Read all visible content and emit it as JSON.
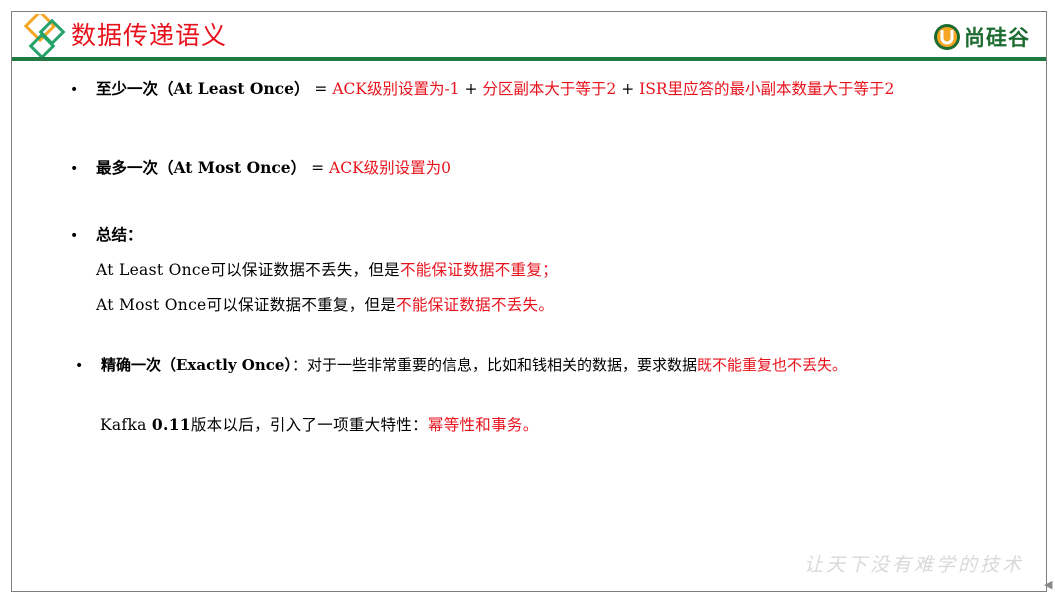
{
  "header": {
    "title": "数据传递语义",
    "brand_name": "尚硅谷",
    "colors": {
      "title": "#e8121c",
      "rule": "#1f7a44",
      "brand": "#1c6b2f",
      "diamond_orange": "#f5a623",
      "diamond_green": "#23a36a"
    }
  },
  "bullet_glyph": "•",
  "items": {
    "at_least_once": {
      "label": "至少一次（At Least Once）",
      "eq": " = ",
      "part1": "ACK级别设置为-1",
      "plus1": " + ",
      "part2": "分区副本大于等于2",
      "plus2": " + ",
      "part3": "ISR里应答的最小副本数量大于等于2"
    },
    "at_most_once": {
      "label": "最多一次（At Most Once）",
      "eq": " = ",
      "part1": "ACK级别设置为0"
    },
    "summary": {
      "label": "总结：",
      "line1_black": "At  Least  Once可以保证数据不丢失，但是",
      "line1_red": "不能保证数据不重复；",
      "line2_black": "At  Most  Once可以保证数据不重复，但是",
      "line2_red": "不能保证数据不丢失。"
    },
    "exactly_once": {
      "label": "精确一次（Exactly  Once）",
      "text_black": "：对于一些非常重要的信息，比如和钱相关的数据，要求数据",
      "text_red": "既不能重复也不丢失。"
    },
    "kafka_note": {
      "black_a": "Kafka  ",
      "version": "0.11",
      "black_b": "版本以后，引入了一项重大特性：",
      "red": "幂等性和事务。"
    }
  },
  "footer": {
    "watermark": "让天下没有难学的技术"
  }
}
